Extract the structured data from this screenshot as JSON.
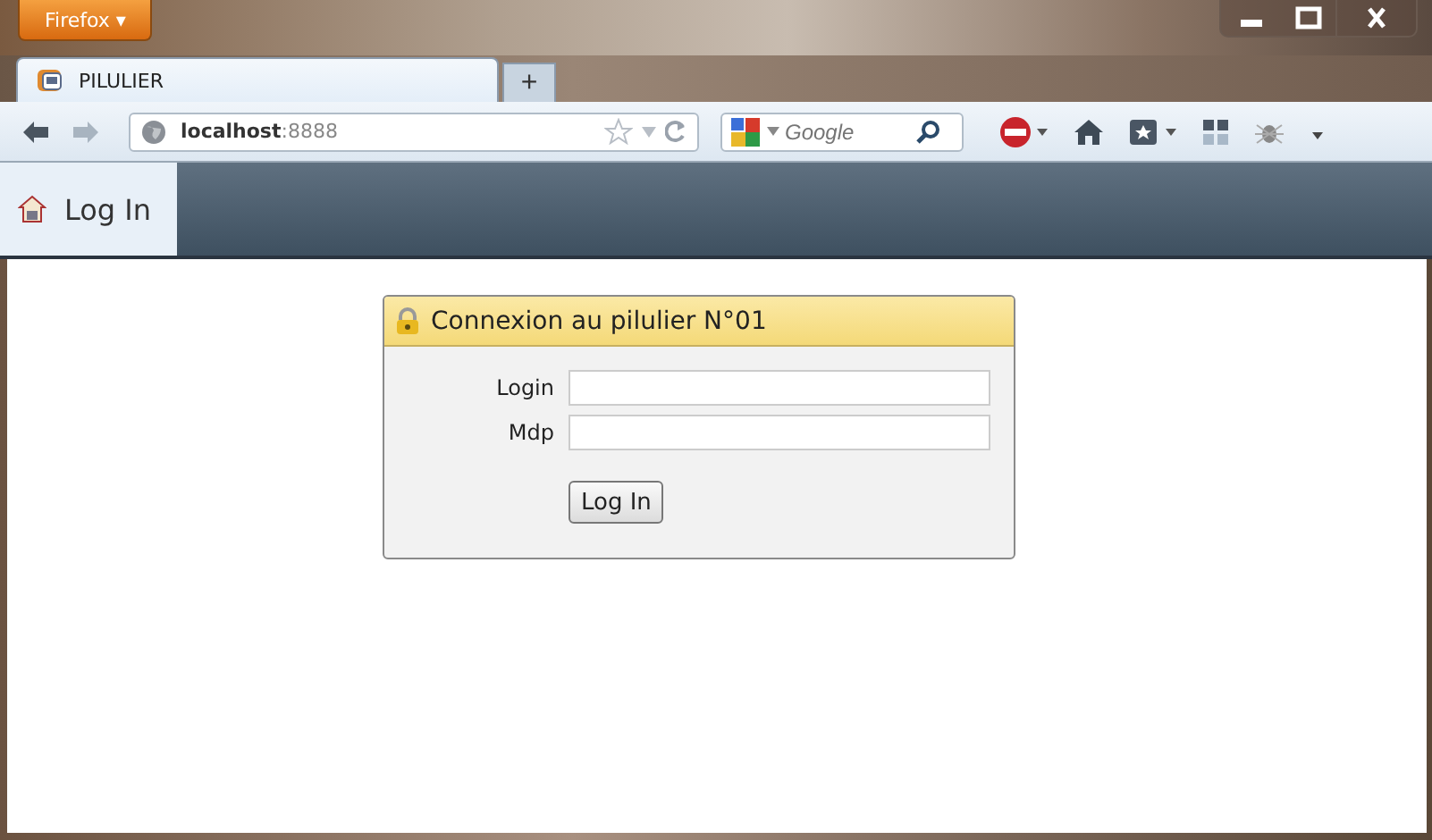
{
  "window": {
    "menu_button": "Firefox ▾"
  },
  "tabs": [
    {
      "label": "PILULIER",
      "selected": true
    }
  ],
  "new_tab": "+",
  "address_bar": {
    "host": "localhost",
    "port": ":8888"
  },
  "search": {
    "placeholder": "Google"
  },
  "app_nav": [
    {
      "label": "Log In",
      "selected": true
    }
  ],
  "login_panel": {
    "title": "Connexion au pilulier N°01",
    "fields": [
      {
        "label": "Login"
      },
      {
        "label": "Mdp"
      }
    ],
    "button": "Log In"
  }
}
